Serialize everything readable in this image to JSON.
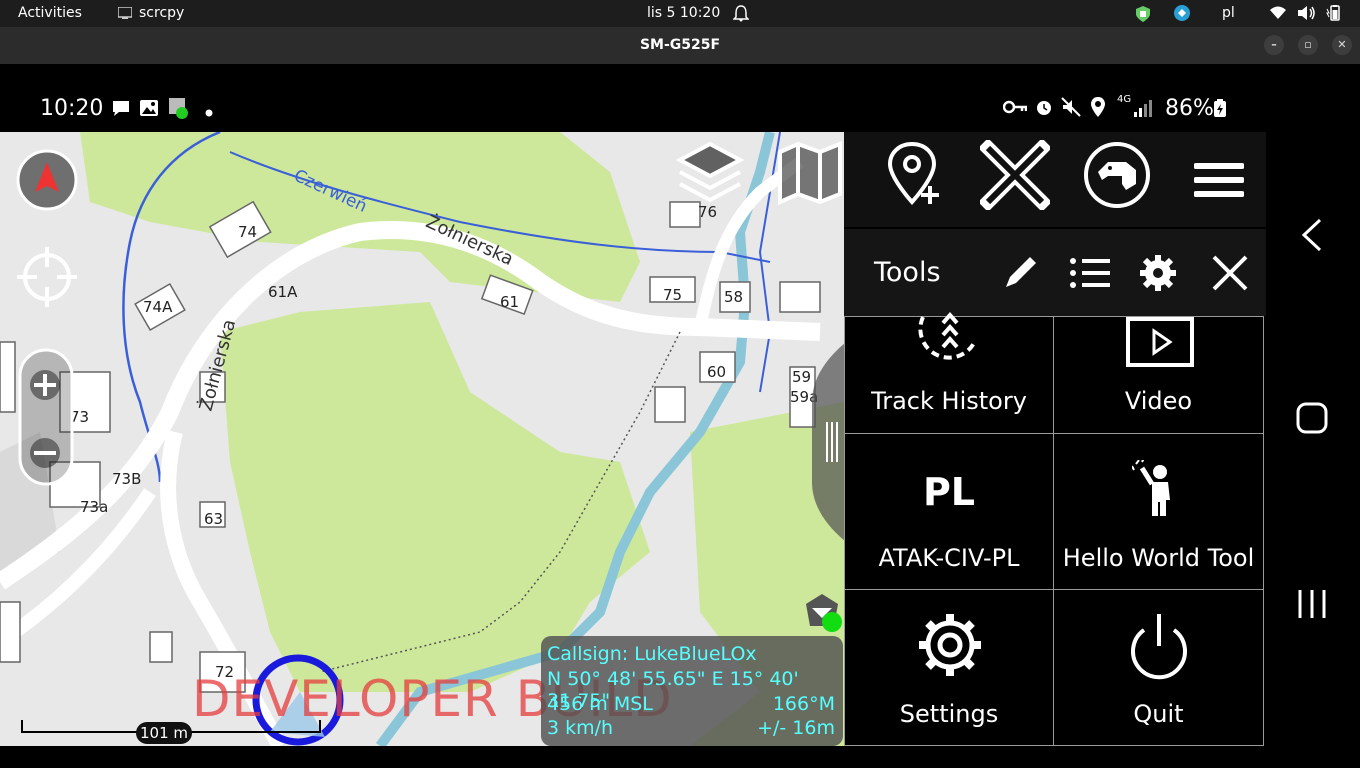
{
  "desktop": {
    "activities": "Activities",
    "app_name": "scrcpy",
    "clock": "lis 5  10:20",
    "keyboard_layout": "pl"
  },
  "window": {
    "title": "SM-G525F"
  },
  "android_status": {
    "time": "10:20",
    "battery": "86%",
    "network": "4G"
  },
  "map": {
    "street_labels": [
      "Czerwień",
      "Żołnierska",
      "Żołnierska"
    ],
    "house_numbers": [
      "74",
      "74A",
      "61A",
      "61",
      "75",
      "58",
      "76",
      "73",
      "73B",
      "73a",
      "63",
      "60",
      "59",
      "59a",
      "72"
    ],
    "scale_label": "101 m",
    "watermark": "DEVELOPER BUILD"
  },
  "location_info": {
    "callsign": "Callsign: LukeBlueLOx",
    "coordinates": "N 50° 48' 55.65\"  E 15° 40' 31.75\"",
    "altitude": "456 m MSL",
    "heading": "166°M",
    "speed": "3 km/h",
    "accuracy": "+/- 16m"
  },
  "tools_panel": {
    "title": "Tools",
    "tiles": [
      {
        "label": "Track History"
      },
      {
        "label": "Video"
      },
      {
        "label": "ATAK-CIV-PL",
        "badge": "PL"
      },
      {
        "label": "Hello World Tool"
      },
      {
        "label": "Settings"
      },
      {
        "label": "Quit"
      }
    ]
  },
  "colors": {
    "accent_cyan": "#55ffff",
    "map_green": "#cde89a",
    "watermark_red": "#e63c3c",
    "self_marker_blue": "#1a1adc"
  }
}
